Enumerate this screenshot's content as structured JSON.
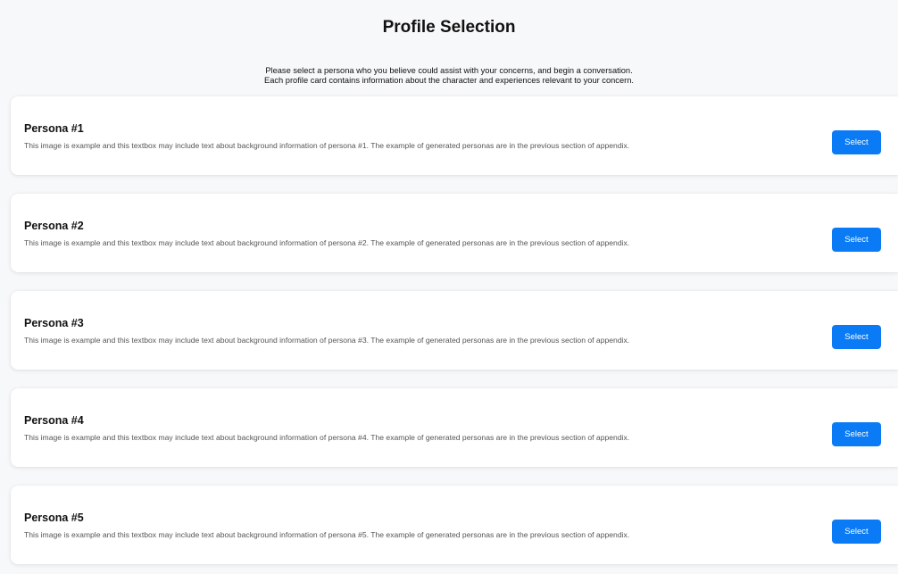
{
  "header": {
    "title": "Profile Selection",
    "intro_line1": "Please select a persona who you believe could assist with your concerns, and begin a conversation.",
    "intro_line2": "Each profile card contains information about the character and experiences relevant to your concern."
  },
  "personas": [
    {
      "name": "Persona #1",
      "description": "This image is example and this textbox may include text about background information of persona #1. The example of generated personas are in the previous section of appendix.",
      "button_label": "Select"
    },
    {
      "name": "Persona #2",
      "description": "This image is example and this textbox may include text about background information of persona #2. The example of generated personas are in the previous section of appendix.",
      "button_label": "Select"
    },
    {
      "name": "Persona #3",
      "description": "This image is example and this textbox may include text about background information of persona #3. The example of generated personas are in the previous section of appendix.",
      "button_label": "Select"
    },
    {
      "name": "Persona #4",
      "description": "This image is example and this textbox may include text about background information of persona #4. The example of generated personas are in the previous section of appendix.",
      "button_label": "Select"
    },
    {
      "name": "Persona #5",
      "description": "This image is example and this textbox may include text about background information of persona #5. The example of generated personas are in the previous section of appendix.",
      "button_label": "Select"
    }
  ],
  "colors": {
    "background": "#f7f8fa",
    "card": "#ffffff",
    "accent_button": "#0a7bf5"
  }
}
